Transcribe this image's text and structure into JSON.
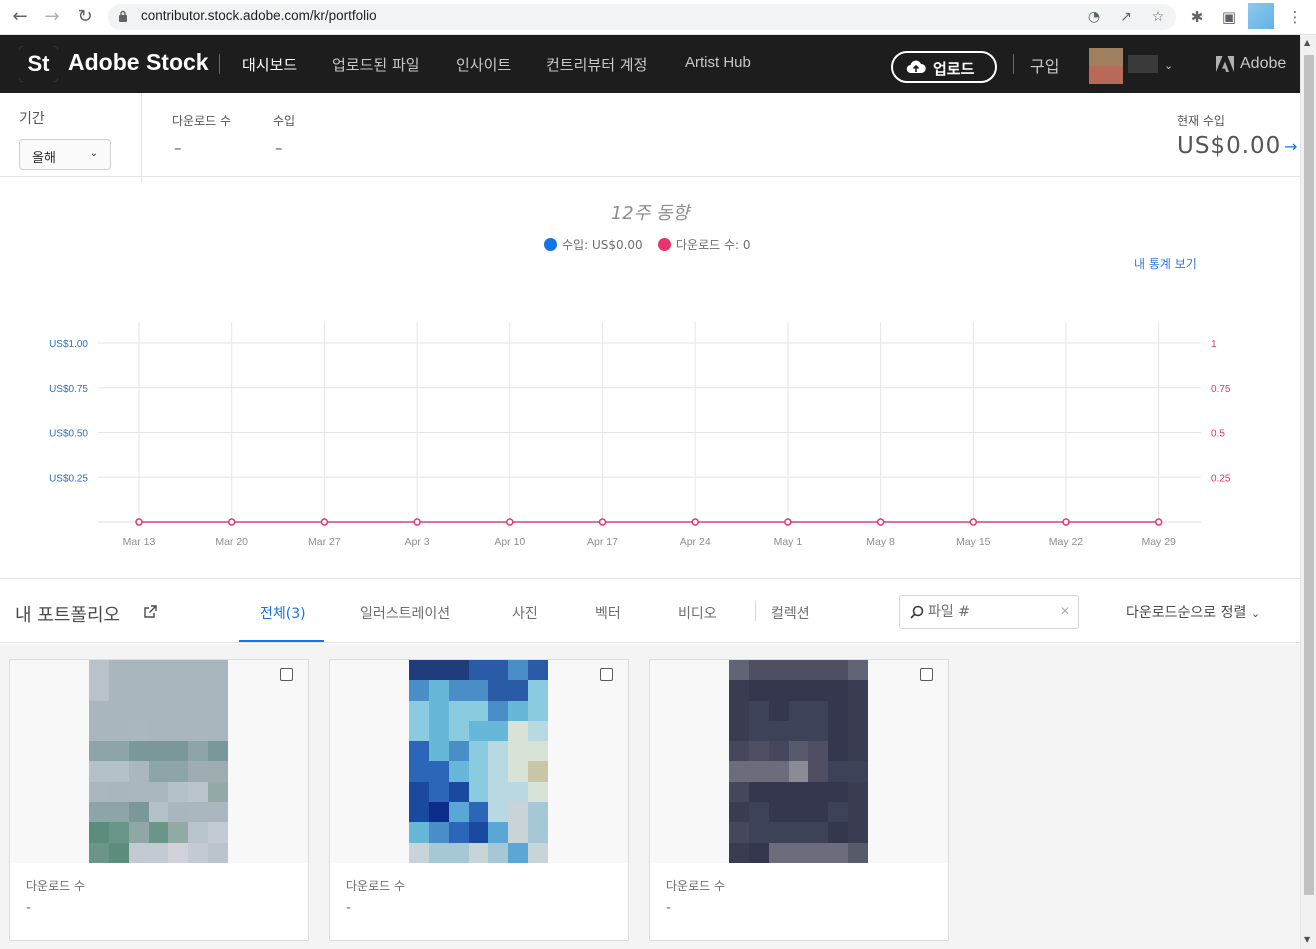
{
  "browser": {
    "url": "contributor.stock.adobe.com/kr/portfolio",
    "icons": [
      "back-icon",
      "forward-icon",
      "reload-icon",
      "lock-icon",
      "performance-icon",
      "share-icon",
      "star-icon",
      "extensions-icon",
      "sidepanel-icon",
      "menu-icon"
    ]
  },
  "header": {
    "logo_text": "St",
    "brand": "Adobe Stock",
    "nav": [
      {
        "label": "대시보드",
        "active": true
      },
      {
        "label": "업로드된 파일",
        "active": false
      },
      {
        "label": "인사이트",
        "active": false
      },
      {
        "label": "컨트리뷰터 계정",
        "active": false
      },
      {
        "label": "Artist Hub",
        "active": false
      }
    ],
    "upload_label": "업로드",
    "buy_label": "구입",
    "adobe_label": "Adobe"
  },
  "stats": {
    "period_label": "기간",
    "period_value": "올해",
    "downloads_label": "다운로드 수",
    "downloads_value": "–",
    "earnings_label": "수입",
    "earnings_value": "–",
    "current_earnings_label": "현재 수입",
    "current_earnings_value": "US$0.00"
  },
  "chart": {
    "title": "12주 동향",
    "legend_earnings": "수입: US$0.00",
    "legend_downloads": "다운로드 수: 0",
    "stats_link": "내 통계 보기"
  },
  "chart_data": {
    "type": "line",
    "x": [
      "Mar 13",
      "Mar 20",
      "Mar 27",
      "Apr 3",
      "Apr 10",
      "Apr 17",
      "Apr 24",
      "May 1",
      "May 8",
      "May 15",
      "May 22",
      "May 29"
    ],
    "series": [
      {
        "name": "수입",
        "axis": "left",
        "color": "#1473e6",
        "values": [
          0,
          0,
          0,
          0,
          0,
          0,
          0,
          0,
          0,
          0,
          0,
          0
        ]
      },
      {
        "name": "다운로드 수",
        "axis": "right",
        "color": "#e8336e",
        "values": [
          0,
          0,
          0,
          0,
          0,
          0,
          0,
          0,
          0,
          0,
          0,
          0
        ]
      }
    ],
    "y_left_ticks": [
      "US$1.00",
      "US$0.75",
      "US$0.50",
      "US$0.25"
    ],
    "y_right_ticks": [
      "1",
      "0.75",
      "0.5",
      "0.25"
    ],
    "ylim": [
      0,
      1
    ],
    "grid": true
  },
  "portfolio": {
    "title": "내 포트폴리오",
    "tabs": [
      {
        "label": "전체(3)",
        "active": true
      },
      {
        "label": "일러스트레이션",
        "active": false
      },
      {
        "label": "사진",
        "active": false
      },
      {
        "label": "벡터",
        "active": false
      },
      {
        "label": "비디오",
        "active": false
      },
      {
        "label": "컬렉션",
        "active": false
      }
    ],
    "search_placeholder": "파일 #",
    "sort_label": "다운로드순으로 정렬",
    "items": [
      {
        "downloads_label": "다운로드 수",
        "downloads_value": "-",
        "palette": [
          "#b7c2c9",
          "#a9b6bd",
          "#aab7bd",
          "#8ea5a8",
          "#7a9898",
          "#b4c2c8",
          "#a0adb0",
          "#8fa8a6",
          "#6a9588",
          "#5b8c7c",
          "#94aaa6",
          "#b9c4cc",
          "#c4cad2",
          "#cfd3d9"
        ]
      },
      {
        "downloads_label": "다운로드 수",
        "downloads_value": "-",
        "palette": [
          "#1f3d7a",
          "#2a5ba6",
          "#4a8ec8",
          "#67b8d8",
          "#8acbe0",
          "#b8d9e2",
          "#d8e2d6",
          "#c9c6a8",
          "#2b66b8",
          "#1a49a0",
          "#0c2c8a",
          "#5aa6d4",
          "#a6c7d6",
          "#c8d4d8"
        ]
      },
      {
        "downloads_label": "다운로드 수",
        "downloads_value": "-",
        "palette": [
          "#4f4f63",
          "#3e4258",
          "#34374d",
          "#3a3d52",
          "#575a6b",
          "#6b6d7c",
          "#8a8b96",
          "#2f3246",
          "#45485c",
          "#616376"
        ]
      }
    ]
  }
}
